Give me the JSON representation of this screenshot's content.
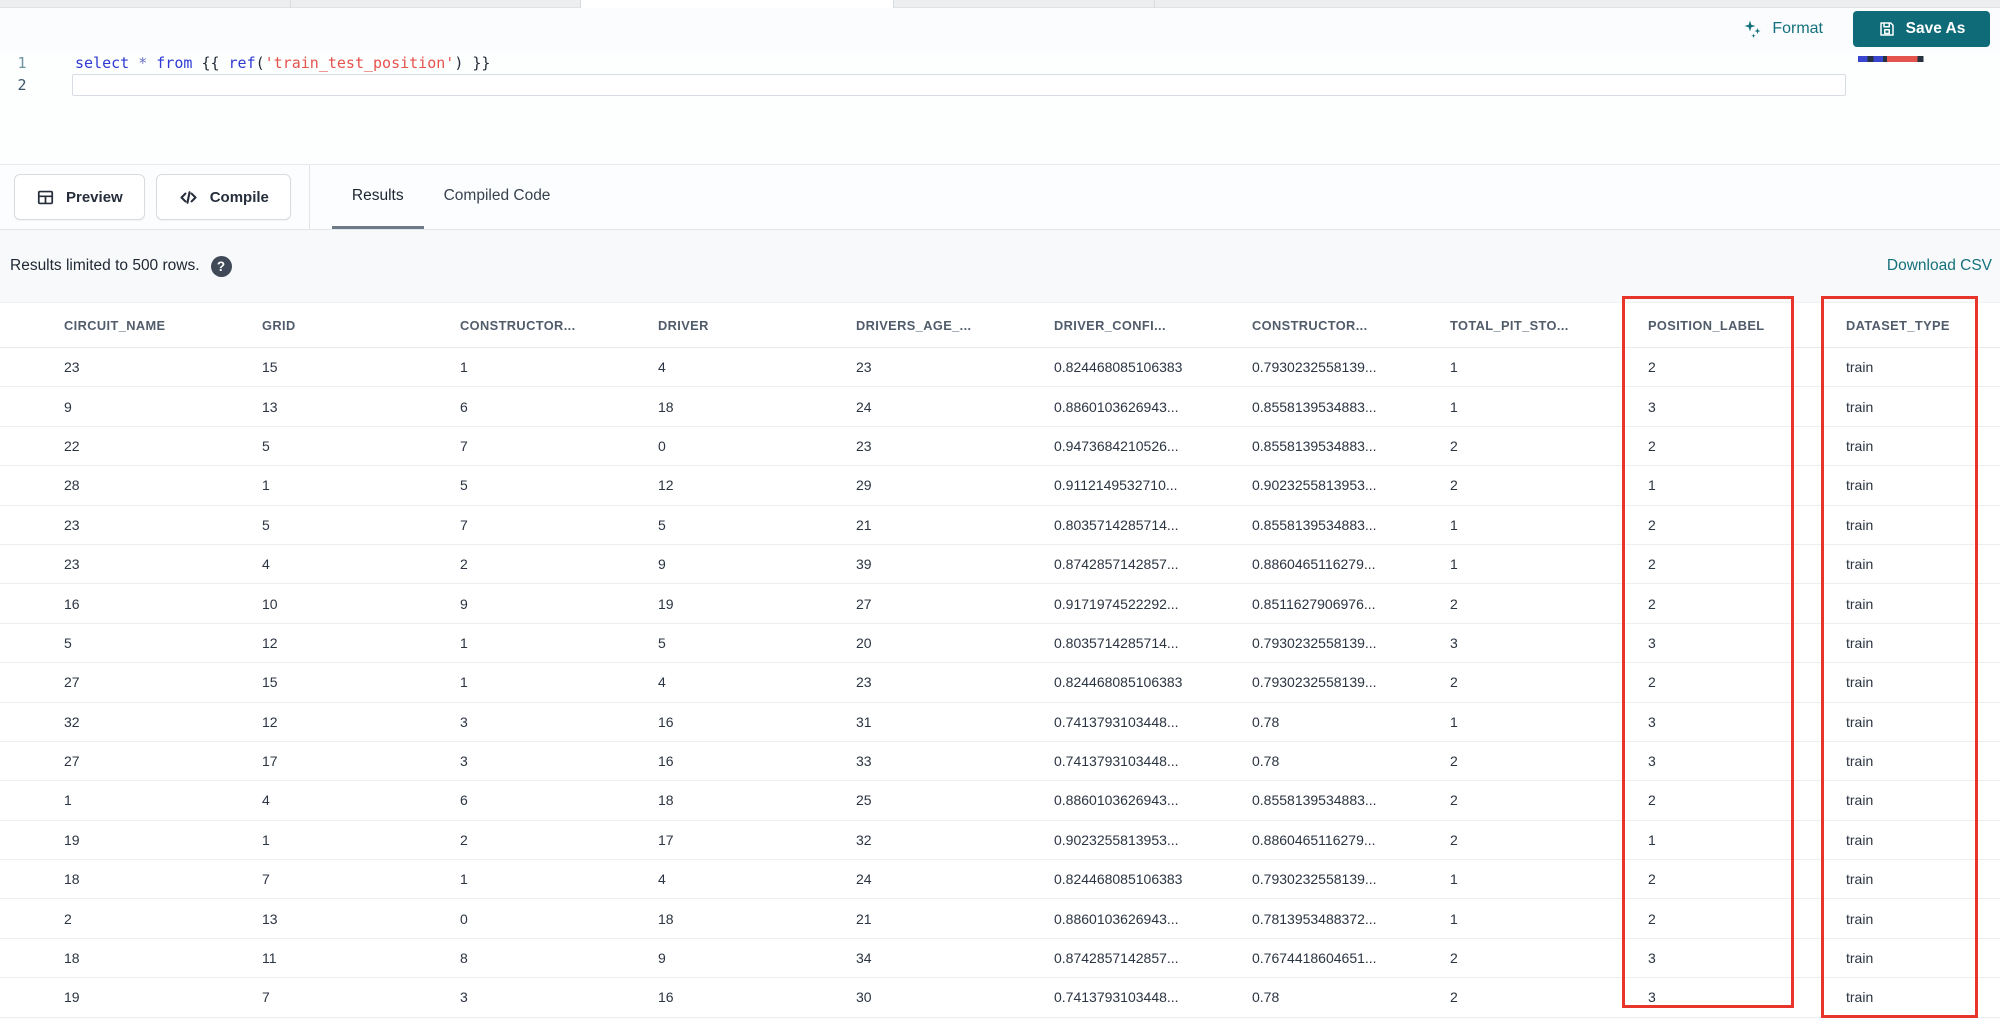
{
  "top_toolbar": {
    "format_label": "Format",
    "save_as_label": "Save As"
  },
  "editor": {
    "lines": [
      {
        "number": "1",
        "tokens": [
          {
            "text": "select",
            "type": "keyword"
          },
          {
            "text": " ",
            "type": "plain"
          },
          {
            "text": "*",
            "type": "operator"
          },
          {
            "text": " ",
            "type": "plain"
          },
          {
            "text": "from",
            "type": "keyword"
          },
          {
            "text": " ",
            "type": "plain"
          },
          {
            "text": "{{ ",
            "type": "bracket"
          },
          {
            "text": "ref",
            "type": "function"
          },
          {
            "text": "(",
            "type": "bracket"
          },
          {
            "text": "'train_test_position'",
            "type": "string"
          },
          {
            "text": ")",
            "type": "bracket"
          },
          {
            "text": " }}",
            "type": "bracket"
          }
        ]
      },
      {
        "number": "2",
        "tokens": []
      }
    ]
  },
  "action_bar": {
    "preview_label": "Preview",
    "compile_label": "Compile",
    "tabs": [
      {
        "label": "Results",
        "active": true
      },
      {
        "label": "Compiled Code",
        "active": false
      }
    ]
  },
  "results_bar": {
    "info_text": "Results limited to 500 rows.",
    "download_label": "Download CSV"
  },
  "table": {
    "columns": [
      "CIRCUIT_NAME",
      "GRID",
      "CONSTRUCTOR...",
      "DRIVER",
      "DRIVERS_AGE_...",
      "DRIVER_CONFI...",
      "CONSTRUCTOR...",
      "TOTAL_PIT_STO...",
      "POSITION_LABEL",
      "DATASET_TYPE"
    ],
    "highlighted_columns": [
      "POSITION_LABEL",
      "DATASET_TYPE"
    ],
    "rows": [
      [
        "23",
        "15",
        "1",
        "4",
        "23",
        "0.824468085106383",
        "0.7930232558139...",
        "1",
        "2",
        "train"
      ],
      [
        "9",
        "13",
        "6",
        "18",
        "24",
        "0.8860103626943...",
        "0.8558139534883...",
        "1",
        "3",
        "train"
      ],
      [
        "22",
        "5",
        "7",
        "0",
        "23",
        "0.9473684210526...",
        "0.8558139534883...",
        "2",
        "2",
        "train"
      ],
      [
        "28",
        "1",
        "5",
        "12",
        "29",
        "0.9112149532710...",
        "0.9023255813953...",
        "2",
        "1",
        "train"
      ],
      [
        "23",
        "5",
        "7",
        "5",
        "21",
        "0.8035714285714...",
        "0.8558139534883...",
        "1",
        "2",
        "train"
      ],
      [
        "23",
        "4",
        "2",
        "9",
        "39",
        "0.8742857142857...",
        "0.8860465116279...",
        "1",
        "2",
        "train"
      ],
      [
        "16",
        "10",
        "9",
        "19",
        "27",
        "0.9171974522292...",
        "0.8511627906976...",
        "2",
        "2",
        "train"
      ],
      [
        "5",
        "12",
        "1",
        "5",
        "20",
        "0.8035714285714...",
        "0.7930232558139...",
        "3",
        "3",
        "train"
      ],
      [
        "27",
        "15",
        "1",
        "4",
        "23",
        "0.824468085106383",
        "0.7930232558139...",
        "2",
        "2",
        "train"
      ],
      [
        "32",
        "12",
        "3",
        "16",
        "31",
        "0.7413793103448...",
        "0.78",
        "1",
        "3",
        "train"
      ],
      [
        "27",
        "17",
        "3",
        "16",
        "33",
        "0.7413793103448...",
        "0.78",
        "2",
        "3",
        "train"
      ],
      [
        "1",
        "4",
        "6",
        "18",
        "25",
        "0.8860103626943...",
        "0.8558139534883...",
        "2",
        "2",
        "train"
      ],
      [
        "19",
        "1",
        "2",
        "17",
        "32",
        "0.9023255813953...",
        "0.8860465116279...",
        "2",
        "1",
        "train"
      ],
      [
        "18",
        "7",
        "1",
        "4",
        "24",
        "0.824468085106383",
        "0.7930232558139...",
        "1",
        "2",
        "train"
      ],
      [
        "2",
        "13",
        "0",
        "18",
        "21",
        "0.8860103626943...",
        "0.7813953488372...",
        "1",
        "2",
        "train"
      ],
      [
        "18",
        "11",
        "8",
        "9",
        "34",
        "0.8742857142857...",
        "0.7674418604651...",
        "2",
        "3",
        "train"
      ],
      [
        "19",
        "7",
        "3",
        "16",
        "30",
        "0.7413793103448...",
        "0.78",
        "2",
        "3",
        "train"
      ]
    ]
  },
  "colors": {
    "teal_accent": "#0e6b77",
    "highlight_red": "#e8352b",
    "keyword_blue": "#2e3ad2",
    "string_red": "#e5534e"
  }
}
